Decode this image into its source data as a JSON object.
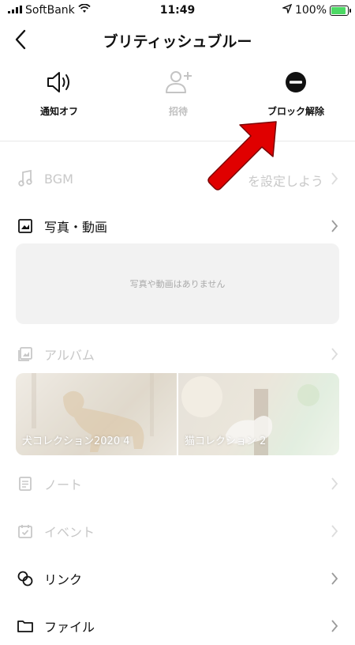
{
  "status": {
    "carrier": "SoftBank",
    "time": "11:49",
    "battery": "100%",
    "battery_level": 1.0
  },
  "header": {
    "title": "ブリティッシュブルー"
  },
  "actions": [
    {
      "label": "通知オフ",
      "icon": "speaker-icon"
    },
    {
      "label": "招待",
      "icon": "add-user-icon"
    },
    {
      "label": "ブロック解除",
      "icon": "minus-circle-icon"
    }
  ],
  "rows": {
    "bgm": {
      "label": "BGM",
      "side": "を設定しよう"
    },
    "media": {
      "label": "写真・動画"
    },
    "album": {
      "label": "アルバム"
    },
    "note": {
      "label": "ノート"
    },
    "event": {
      "label": "イベント"
    },
    "link": {
      "label": "リンク"
    },
    "file": {
      "label": "ファイル"
    }
  },
  "media_empty": "写真や動画はありません",
  "albums": [
    {
      "title": "犬コレクション2020",
      "count": "4"
    },
    {
      "title": "猫コレクション",
      "count": "2"
    }
  ],
  "colors": {
    "accent_arrow": "#e00000",
    "muted": "#c8c8c8"
  }
}
